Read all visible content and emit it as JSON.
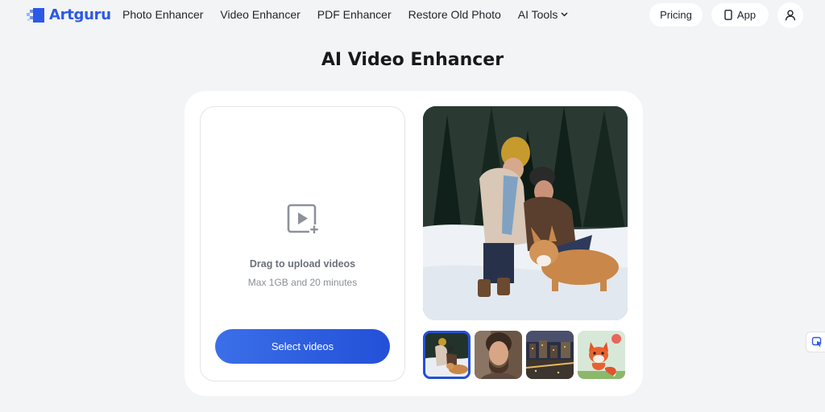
{
  "brand": {
    "name": "Artguru",
    "accent": "#2b59e6"
  },
  "nav": {
    "items": [
      {
        "label": "Photo Enhancer"
      },
      {
        "label": "Video Enhancer"
      },
      {
        "label": "PDF Enhancer"
      },
      {
        "label": "Restore Old Photo"
      },
      {
        "label": "AI Tools",
        "icon": "chevron-down-icon"
      }
    ],
    "pricing_label": "Pricing",
    "app_label": "App",
    "app_icon": "phone-icon",
    "user_icon": "user-icon"
  },
  "page": {
    "title": "AI Video Enhancer"
  },
  "upload": {
    "icon": "video-add-icon",
    "drag_text": "Drag to upload videos",
    "limit_text": "Max 1GB and 20 minutes",
    "button_label": "Select videos",
    "button_color": "#2d5ce0"
  },
  "samples": {
    "preview": "couple-with-dog-in-snow",
    "thumbnails": [
      {
        "name": "couple-with-dog-in-snow",
        "active": true
      },
      {
        "name": "bearded-man-portrait",
        "active": false
      },
      {
        "name": "city-night-aerial",
        "active": false
      },
      {
        "name": "cartoon-fox",
        "active": false
      }
    ]
  },
  "floating_button_icon": "chat-icon"
}
